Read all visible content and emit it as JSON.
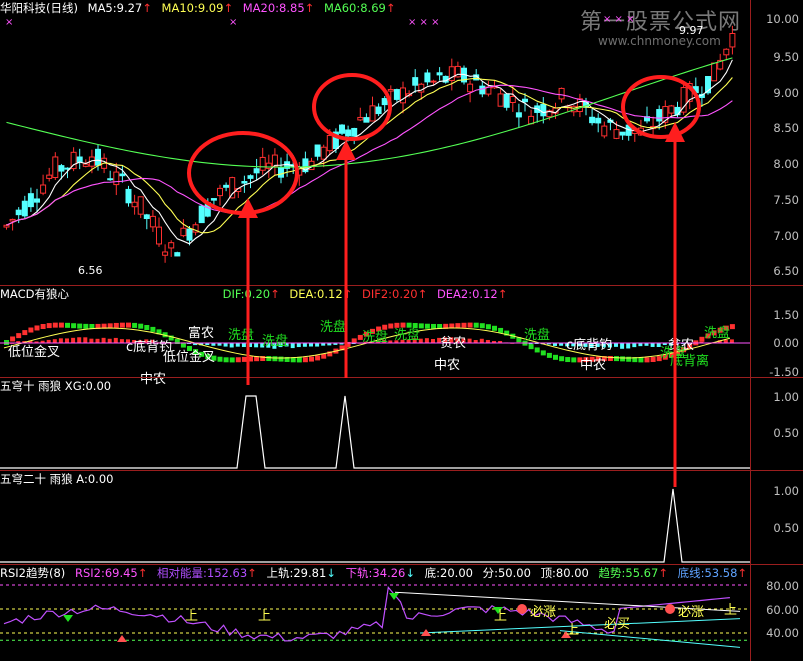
{
  "price": {
    "name": "华阳科技(日线)",
    "ma5": "MA5:9.27",
    "ma10": "MA10:9.09",
    "ma20": "MA20:8.85",
    "ma60": "MA60:8.69",
    "ticks": [
      "10.00",
      "9.50",
      "9.00",
      "8.50",
      "8.00",
      "7.50",
      "7.00",
      "6.50"
    ],
    "low_label": "6.56",
    "high_label": "9.97",
    "colors": {
      "up": "#ff3030",
      "down": "#54ffff",
      "ma5": "#ffffff",
      "ma10": "#ffff54",
      "ma20": "#ff54ff",
      "ma60": "#54ff54"
    }
  },
  "macd": {
    "name": "MACD有狼心",
    "dif": "DIF:0.20",
    "dea": "DEA:0.12",
    "dif2": "DIF2:0.20",
    "dea2": "DEA2:0.12",
    "ticks": [
      "1.50",
      "0.00",
      "-1.50"
    ],
    "labels": [
      "低位金叉",
      "中农",
      "c底背钓",
      "低位金叉",
      "富农",
      "洗盘",
      "洗盘",
      "洗盘",
      "洗盘",
      "洗盘",
      "贫农",
      "中农",
      "洗盘",
      "c底背钓",
      "中农",
      "贫农",
      "洗盘",
      "底背离",
      "洗盘"
    ]
  },
  "xg": {
    "name": "五穹十 雨狼 XG:0.00",
    "ticks": [
      "1.00",
      "0.50"
    ]
  },
  "a": {
    "name": "五穹二十 雨狼 A:0.00",
    "ticks": [
      "1.00",
      "0.50"
    ]
  },
  "rsi": {
    "name": "RSI2趋势(8)",
    "rsi2": "RSI2:69.45",
    "rel": "相对能量:152.63",
    "upper": "上轨:29.81",
    "lower": "下轨:34.26",
    "bottom": "底:20.00",
    "fen": "分:50.00",
    "top": "顶:80.00",
    "trend": "趋势:55.67",
    "baseline": "底线:53.58",
    "ticks": [
      "80.00",
      "60.00",
      "40.00"
    ],
    "labels": [
      "上",
      "上",
      "上",
      "必涨",
      "必买",
      "上",
      "必涨",
      "上"
    ]
  },
  "watermark": {
    "title": "第一股票公式网",
    "url": "www.chnmoney.com"
  }
}
